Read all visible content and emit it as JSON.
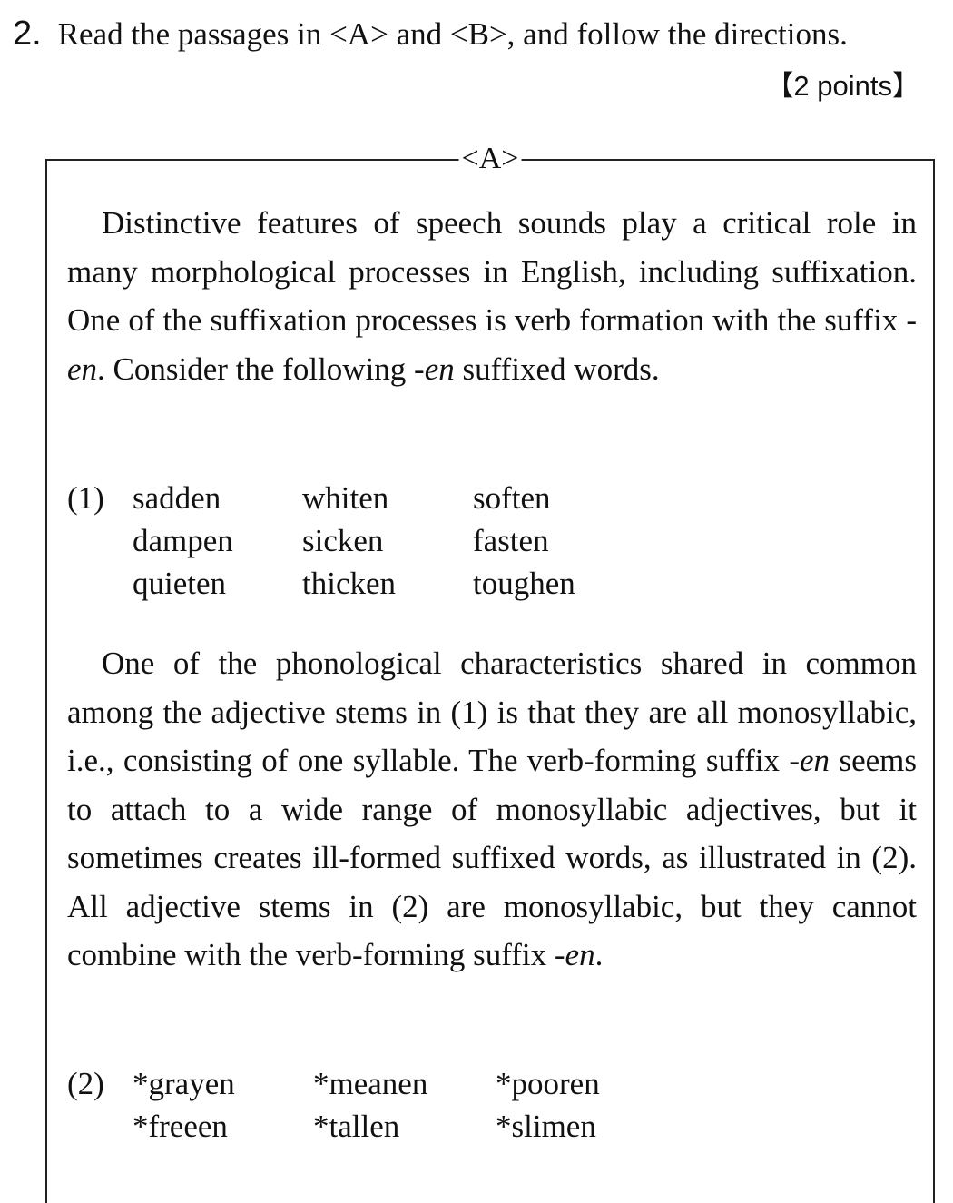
{
  "question": {
    "number": "2.",
    "prompt": "Read the passages in <A> and <B>, and follow the directions.",
    "points": "【2 points】"
  },
  "passage_a": {
    "label": "<A>",
    "paragraph1": {
      "part1": "Distinctive features of speech sounds play a critical role in many morphological processes in English, including suffixation. One of the suffixation processes is verb formation with the suffix ",
      "suffix1": "-en",
      "part2": ". Consider the following ",
      "suffix2": "-en",
      "part3": " suffixed words."
    },
    "example1": {
      "number": "(1)",
      "words": [
        "sadden",
        "whiten",
        "soften",
        "dampen",
        "sicken",
        "fasten",
        "quieten",
        "thicken",
        "toughen"
      ]
    },
    "paragraph2": {
      "part1": "One of the phonological characteristics shared in common among the adjective stems in (1) is that they are all monosyllabic, i.e., consisting of one syllable. The verb-forming suffix ",
      "suffix1": "-en",
      "part2": " seems to attach to a wide range of monosyllabic adjectives, but it sometimes creates ill-formed suffixed words, as illustrated in (2). All adjective stems in (2) are monosyllabic, but they cannot combine with the verb-forming suffix ",
      "suffix2": "-en",
      "part3": "."
    },
    "example2": {
      "number": "(2)",
      "words": [
        "*grayen",
        "*meanen",
        "*pooren",
        "*freeen",
        "*tallen",
        "*slimen"
      ]
    }
  }
}
